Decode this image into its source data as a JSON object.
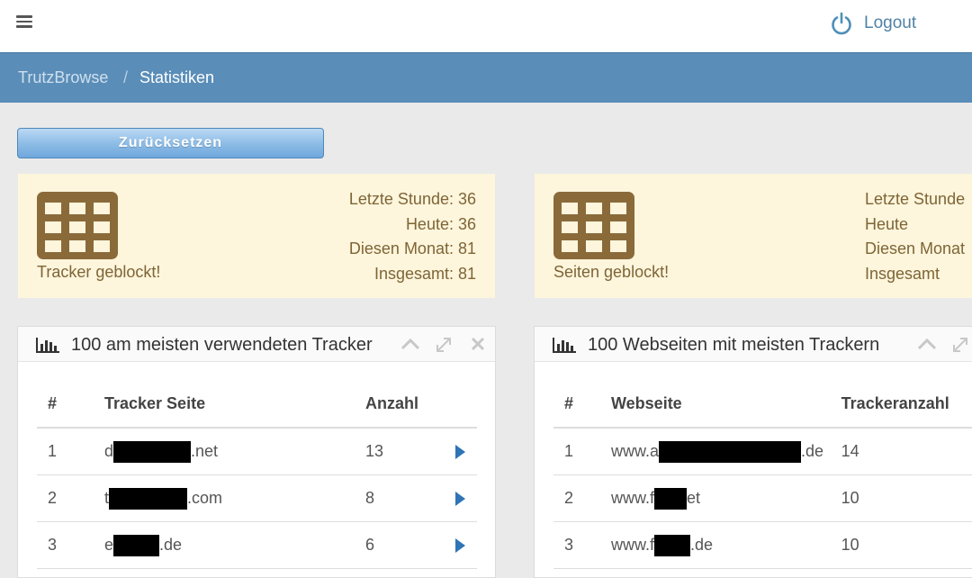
{
  "topbar": {
    "menu_icon": "hamburger-menu-icon",
    "logout_icon": "power-icon",
    "logout_label": "Logout"
  },
  "breadcrumb": {
    "home": "TrutzBrowse",
    "separator": "/",
    "current": "Statistiken"
  },
  "reset_button": "Zurücksetzen",
  "stat_cards": [
    {
      "icon": "table-grid-icon",
      "label": "Tracker geblockt!",
      "lines": [
        "Letzte Stunde: 36",
        "Heute: 36",
        "Diesen Monat: 81",
        "Insgesamt: 81"
      ]
    },
    {
      "icon": "table-grid-icon",
      "label": "Seiten geblockt!",
      "lines": [
        "Letzte Stunde",
        "Heute",
        "Diesen Monat",
        "Insgesamt"
      ]
    }
  ],
  "panels": [
    {
      "title": "100 am meisten verwendeten Tracker",
      "columns": [
        "#",
        "Tracker Seite",
        "Anzahl"
      ],
      "rows": [
        {
          "rank": "1",
          "prefix": "d",
          "suffix": ".net",
          "count": "13"
        },
        {
          "rank": "2",
          "prefix": "t",
          "suffix": ".com",
          "count": "8"
        },
        {
          "rank": "3",
          "prefix": "e",
          "suffix": ".de",
          "count": "6"
        }
      ]
    },
    {
      "title": "100 Webseiten mit meisten Trackern",
      "columns": [
        "#",
        "Webseite",
        "Trackeranzahl"
      ],
      "rows": [
        {
          "rank": "1",
          "prefix": "www.a",
          "suffix": ".de",
          "count": "14"
        },
        {
          "rank": "2",
          "prefix": "www.f",
          "suffix": "et",
          "count": "10"
        },
        {
          "rank": "3",
          "prefix": "www.f",
          "suffix": ".de",
          "count": "10"
        }
      ]
    }
  ],
  "colors": {
    "breadcrumb_bg": "#5a8db8",
    "card_bg": "#fdf5dc",
    "card_text": "#7e6536",
    "icon_brown": "#8b6a3a",
    "link_blue": "#2f74b5"
  }
}
